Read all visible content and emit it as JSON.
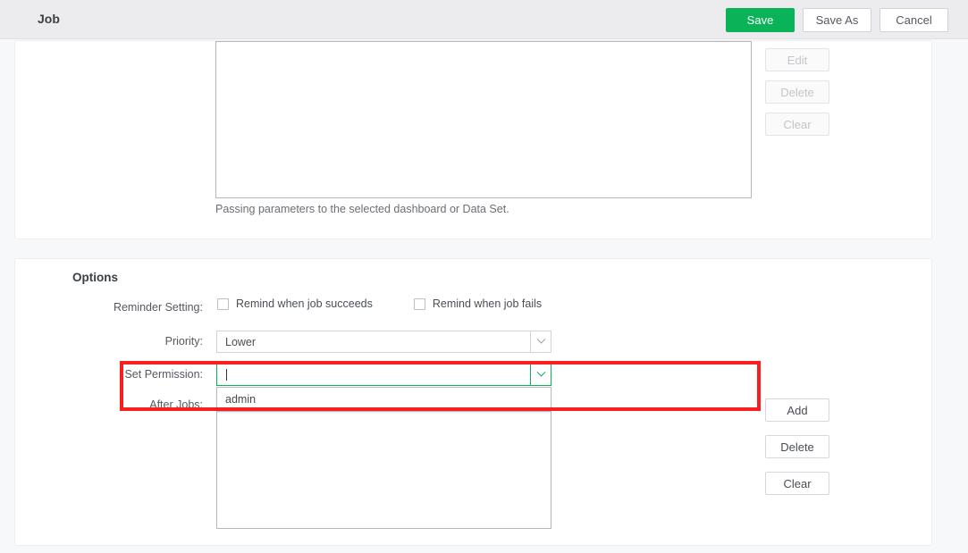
{
  "header": {
    "title": "Job",
    "buttons": {
      "save": "Save",
      "save_as": "Save As",
      "cancel": "Cancel"
    },
    "accent_color": "#0ab258",
    "background_color": "#ececee"
  },
  "parameters_panel": {
    "hint": "Passing parameters to the selected dashboard or Data Set.",
    "side_buttons": [
      {
        "label": "Edit",
        "disabled": true
      },
      {
        "label": "Delete",
        "disabled": true
      },
      {
        "label": "Clear",
        "disabled": true
      }
    ]
  },
  "options_panel": {
    "title": "Options",
    "reminder": {
      "label": "Reminder Setting:",
      "checkboxes": [
        {
          "label": "Remind when job succeeds",
          "checked": false
        },
        {
          "label": "Remind when job fails",
          "checked": false
        }
      ]
    },
    "priority": {
      "label": "Priority:",
      "value": "Lower"
    },
    "set_permission": {
      "label": "Set Permission:",
      "value": "",
      "focused": true,
      "focus_color": "#0ab258",
      "dropdown_open": true,
      "options": [
        "admin"
      ]
    },
    "after_jobs": {
      "label": "After Jobs:",
      "items": [],
      "buttons": [
        {
          "label": "Add",
          "disabled": false
        },
        {
          "label": "Delete",
          "disabled": false
        },
        {
          "label": "Clear",
          "disabled": false
        }
      ]
    }
  },
  "annotation": {
    "highlight_color": "#fa1f1f"
  }
}
